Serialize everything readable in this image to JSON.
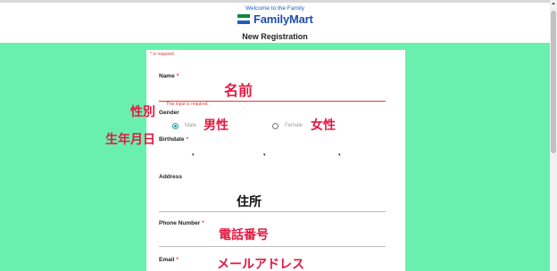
{
  "header": {
    "welcome": "Welcome to the Family",
    "logo_text": "FamilyMart",
    "page_title": "New Registration"
  },
  "form": {
    "required_note": "* is required",
    "name": {
      "label": "Name",
      "required": "*",
      "error": "This input is required.",
      "annotation": "名前"
    },
    "gender": {
      "label": "Gender",
      "annotation": "性別",
      "options": [
        {
          "label": "Male",
          "annotation": "男性",
          "selected": true
        },
        {
          "label": "Female",
          "annotation": "女性",
          "selected": false
        }
      ]
    },
    "birthdate": {
      "label": "Birthdate",
      "required": "*",
      "annotation": "生年月日",
      "caret": "▾"
    },
    "address": {
      "label": "Address",
      "annotation": "住所"
    },
    "phone": {
      "label": "Phone Number",
      "required": "*",
      "annotation": "電話番号"
    },
    "email": {
      "label": "Email",
      "required": "*",
      "annotation": "メールアドレス"
    }
  },
  "colors": {
    "background": "#69f0ae",
    "annotation_red": "#e5173f",
    "radio_accent": "#26a69a",
    "error": "#e53935"
  }
}
